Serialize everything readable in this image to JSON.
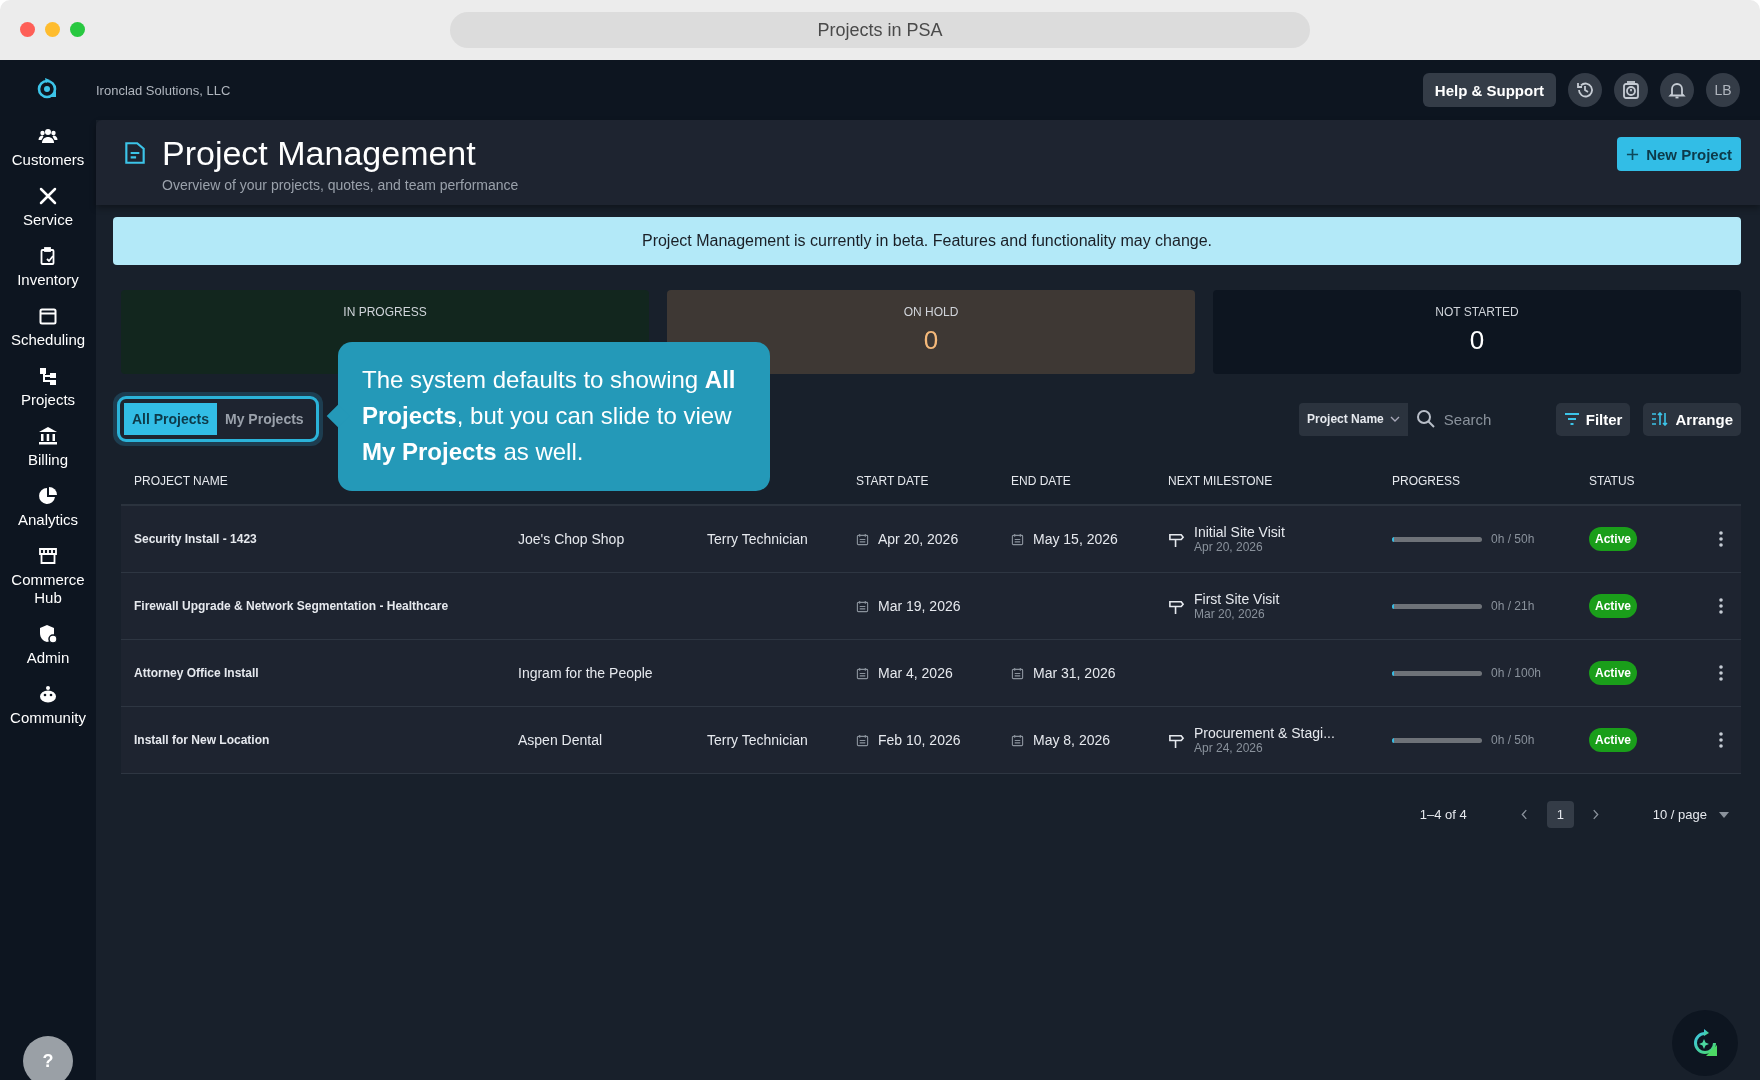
{
  "window": {
    "title": "Projects in PSA"
  },
  "top_bar": {
    "company": "Ironclad Solutions, LLC",
    "help_button": "Help & Support",
    "avatar": "LB"
  },
  "sidebar": {
    "items": [
      {
        "label": "Customers"
      },
      {
        "label": "Service"
      },
      {
        "label": "Inventory"
      },
      {
        "label": "Scheduling"
      },
      {
        "label": "Projects"
      },
      {
        "label": "Billing"
      },
      {
        "label": "Analytics"
      },
      {
        "label": "Commerce Hub"
      },
      {
        "label": "Admin"
      },
      {
        "label": "Community"
      }
    ],
    "help": "?"
  },
  "header": {
    "title": "Project Management",
    "subtitle": "Overview of your projects, quotes, and team performance",
    "new_button": "New Project"
  },
  "banner": "Project Management is currently in beta. Features and functionality may change.",
  "stats": [
    {
      "label": "IN PROGRESS",
      "kind": "progress"
    },
    {
      "label": "ON HOLD",
      "value": "0",
      "kind": "hold"
    },
    {
      "label": "NOT STARTED",
      "value": "0",
      "kind": "idle"
    }
  ],
  "view_toggle": [
    {
      "label": "All Projects",
      "selected": true
    },
    {
      "label": "My Projects",
      "selected": false
    }
  ],
  "tooltip": "The system defaults to showing **All Projects**, but you can slide to view **My Projects** as well.",
  "toolbar": {
    "sort_field": "Project Name",
    "search_placeholder": "Search",
    "filter_button": "Filter",
    "arrange_button": "Arrange"
  },
  "table": {
    "columns": [
      "PROJECT NAME",
      "START DATE",
      "END DATE",
      "NEXT MILESTONE",
      "PROGRESS",
      "STATUS"
    ],
    "rows": [
      {
        "name": "Security Install - 1423",
        "customer": "Joe's Chop Shop",
        "technician": "Terry Technician",
        "start_date": "Apr 20, 2026",
        "end_date": "May 15, 2026",
        "milestone": {
          "name": "Initial Site Visit",
          "date": "Apr 20, 2026"
        },
        "level": 0,
        "hours": "0h / 50h",
        "status": "Active"
      },
      {
        "name": "Firewall Upgrade & Network Segmentation - Healthcare",
        "start_date": "Mar 19, 2026",
        "milestone": {
          "name": "First Site Visit",
          "date": "Mar 20, 2026"
        },
        "level": 0,
        "hours": "0h / 21h",
        "status": "Active"
      },
      {
        "name": "Attorney Office Install",
        "customer": "Ingram for the People",
        "start_date": "Mar 4, 2026",
        "end_date": "Mar 31, 2026",
        "level": 0,
        "hours": "0h / 100h",
        "status": "Active"
      },
      {
        "name": "Install for New Location",
        "customer": "Aspen Dental",
        "technician": "Terry Technician",
        "start_date": "Feb 10, 2026",
        "end_date": "May 8, 2026",
        "milestone": {
          "name": "Procurement & Stagi...",
          "date": "Apr 24, 2026"
        },
        "level": 0,
        "hours": "0h / 50h",
        "status": "Active"
      }
    ]
  },
  "pagination": {
    "range": "1–4 of 4",
    "pages": [
      {
        "label": "1",
        "selected": true
      }
    ],
    "page_size": "10 / page"
  }
}
